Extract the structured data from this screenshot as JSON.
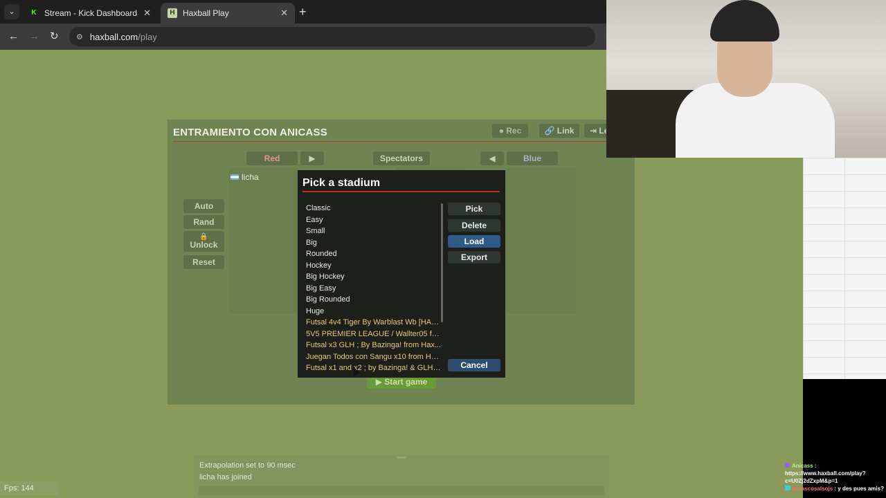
{
  "browser": {
    "tabs": [
      {
        "title": "Stream - Kick Dashboard",
        "favicon": "K",
        "active": false
      },
      {
        "title": "Haxball Play",
        "favicon": "H",
        "active": true
      }
    ],
    "new_tab": "+",
    "url_host": "haxball.com",
    "url_path": "/play"
  },
  "room": {
    "title": "ENTRAMIENTO CON ANICASS",
    "top_buttons": {
      "rec": "● Rec",
      "link": "🔗 Link",
      "leave": "⇥ Le"
    },
    "teams": {
      "red": "Red",
      "spectators": "Spectators",
      "blue": "Blue"
    },
    "arrows": {
      "to_red": "▶",
      "to_blue": "◀"
    },
    "spectators": [
      {
        "name": "licha"
      }
    ],
    "side_buttons": {
      "auto": "Auto",
      "rand": "Rand",
      "unlock": "Unlock",
      "lock_icon": "🔒",
      "reset": "Reset"
    },
    "start_game": "▶ Start game"
  },
  "modal": {
    "title": "Pick a stadium",
    "stadiums": [
      {
        "name": "Classic",
        "custom": false
      },
      {
        "name": "Easy",
        "custom": false
      },
      {
        "name": "Small",
        "custom": false
      },
      {
        "name": "Big",
        "custom": false
      },
      {
        "name": "Rounded",
        "custom": false
      },
      {
        "name": "Hockey",
        "custom": false
      },
      {
        "name": "Big Hockey",
        "custom": false
      },
      {
        "name": "Big Easy",
        "custom": false
      },
      {
        "name": "Big Rounded",
        "custom": false
      },
      {
        "name": "Huge",
        "custom": false
      },
      {
        "name": "Futsal 4v4 Tiger By Warblast Wb [HAX...",
        "custom": true
      },
      {
        "name": "5V5 PREMIER LEAGUE / Wallter05 fro...",
        "custom": true
      },
      {
        "name": "Futsal x3 GLH ; By Bazinga! from Hax...",
        "custom": true
      },
      {
        "name": "Juegan Todos con Sangu x10 from Ha...",
        "custom": true
      },
      {
        "name": "Futsal x1 and x2 ; by Bazinga! & GLH f...",
        "custom": true
      }
    ],
    "buttons": {
      "pick": "Pick",
      "delete": "Delete",
      "load": "Load",
      "export": "Export",
      "cancel": "Cancel"
    }
  },
  "log": {
    "lines": [
      "Extrapolation set to 90 msec",
      "licha has joined"
    ]
  },
  "fps": "Fps: 144",
  "chat": {
    "user1": "Anicass",
    "message1": "https://www.haxball.com/play?c=U0Zj2dZxpM&p=1",
    "user2": "lamascosalsojs",
    "message2": ": y des pues amis?"
  }
}
